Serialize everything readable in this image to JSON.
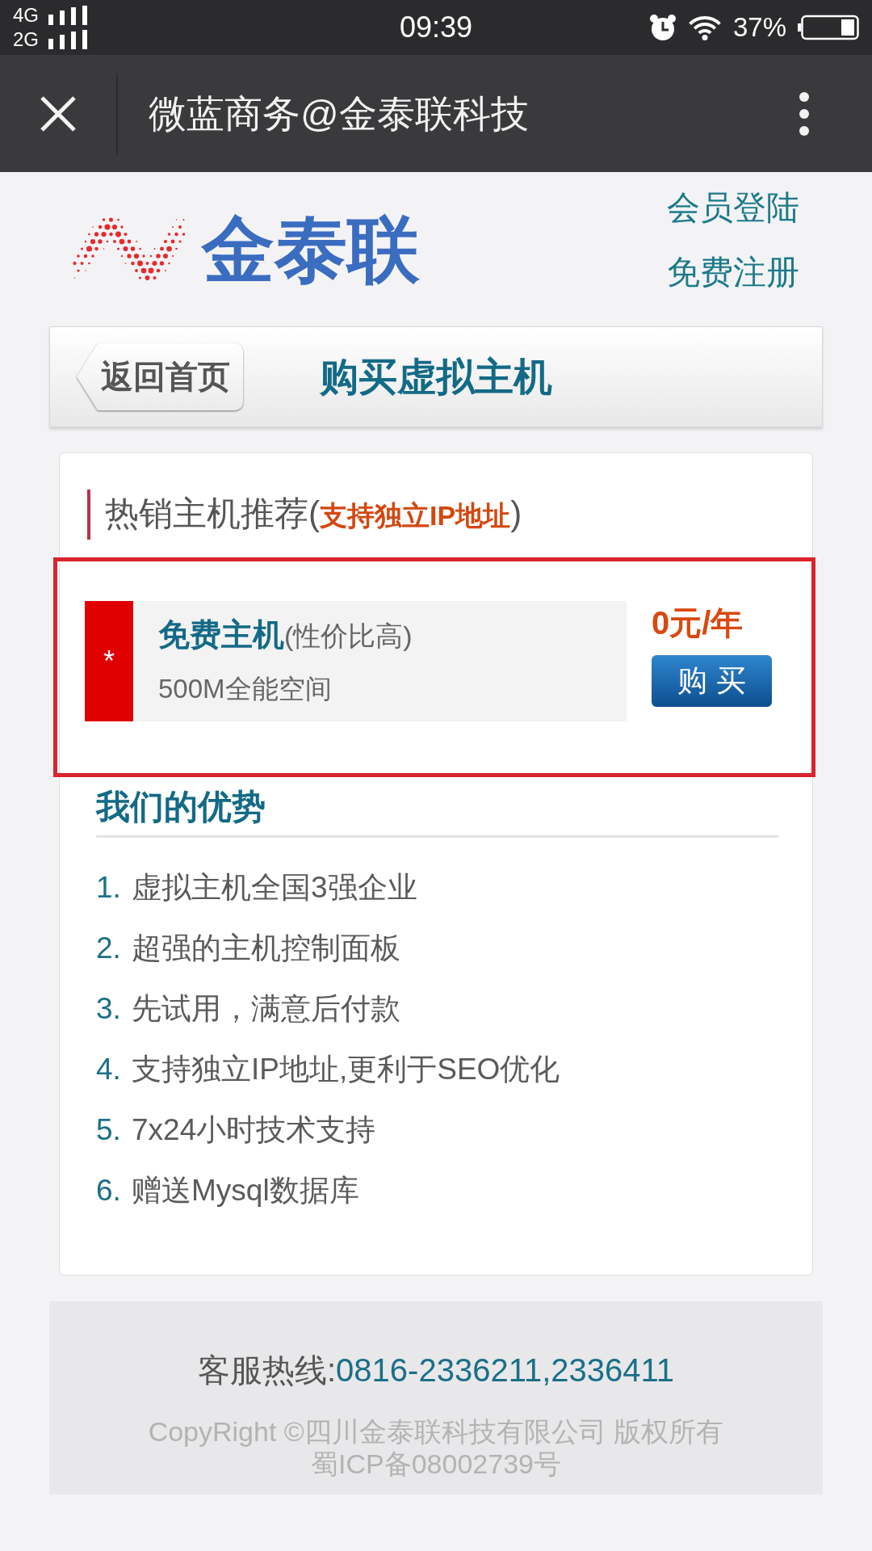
{
  "status_bar": {
    "networks": [
      {
        "label": "4G"
      },
      {
        "label": "2G"
      }
    ],
    "time": "09:39",
    "battery_percent": "37%"
  },
  "title_bar": {
    "title": "微蓝商务@金泰联科技"
  },
  "header": {
    "logo_text": "金泰联",
    "links": [
      "会员登陆",
      "免费注册"
    ]
  },
  "nav_bar": {
    "back_button": "返回首页",
    "title": "购买虚拟主机"
  },
  "hot_section": {
    "title": "热销主机推荐(**支持独立IP地址**)",
    "products": [
      {
        "highlighted": true,
        "marker": "*",
        "name": "免费主机",
        "note": "(性价比高)",
        "description": "500M全能空间",
        "price": "0元/年",
        "button": "购 买"
      }
    ]
  },
  "advantages": {
    "title": "我们的优势",
    "items": [
      {
        "number": "1.",
        "text": "虚拟主机全国3强企业"
      },
      {
        "number": "2.",
        "text": "超强的主机控制面板"
      },
      {
        "number": "3.",
        "text": "先试用，满意后付款"
      },
      {
        "number": "4.",
        "text": "支持独立IP地址,更利于SEO优化"
      },
      {
        "number": "5.",
        "text": "7x24小时技术支持"
      },
      {
        "number": "6.",
        "text": "赠送Mysql数据库"
      }
    ]
  },
  "footer": {
    "hotline_label": "客服热线:",
    "hotline": "0816-2336211,2336411",
    "copyright": "CopyRight ©四川金泰联科技有限公司 版权所有",
    "icp": "蜀ICP备08002739号"
  }
}
